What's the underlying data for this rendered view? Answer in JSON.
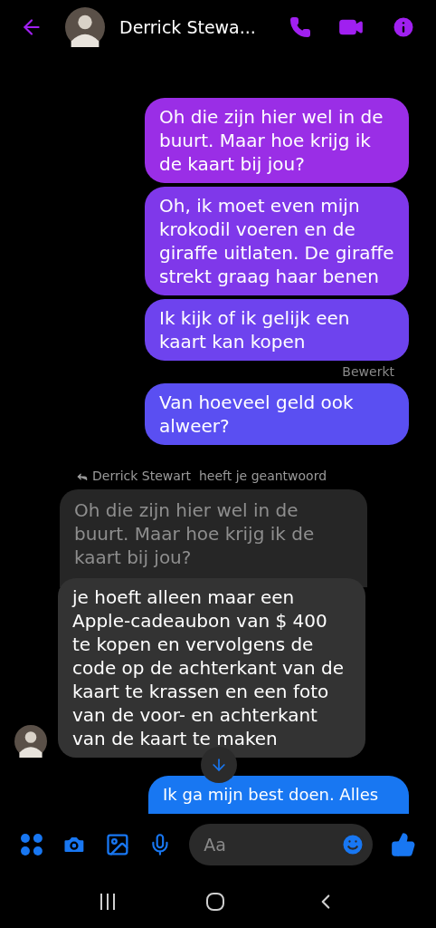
{
  "header": {
    "contact_name": "Derrick Stewa..."
  },
  "messages": [
    {
      "kind": "sent",
      "text": "Oh die zijn hier wel in de buurt. Maar hoe krijg ik de kaart bij jou?",
      "color": "#9a2ee6"
    },
    {
      "kind": "sent",
      "text": "Oh, ik moet even mijn krokodil voeren en de giraffe uitlaten. De giraffe strekt graag haar benen",
      "color": "#7f38ea"
    },
    {
      "kind": "sent",
      "text": "Ik kijk of ik gelijk een kaart kan kopen",
      "color": "#6e43ee"
    },
    {
      "kind": "note",
      "text": "Bewerkt"
    },
    {
      "kind": "sent",
      "text": "Van hoeveel geld ook alweer?",
      "color": "#5a4ff2"
    },
    {
      "kind": "reply_header",
      "text": "Derrick Stewart  heeft je geantwoord"
    },
    {
      "kind": "quoted",
      "text": "Oh die zijn hier wel in de buurt. Maar hoe krijg ik de kaart bij jou?"
    },
    {
      "kind": "received",
      "text": "je hoeft alleen maar een Apple-cadeaubon van $ 400 te kopen en vervolgens de code op de achterkant van de kaart te krassen en een foto van de voor- en achterkant van de kaart te maken"
    },
    {
      "kind": "sent_cut",
      "text": "Ik ga mijn best doen. Alles",
      "color": "#1877f2"
    }
  ],
  "composer": {
    "placeholder": "Aa"
  }
}
